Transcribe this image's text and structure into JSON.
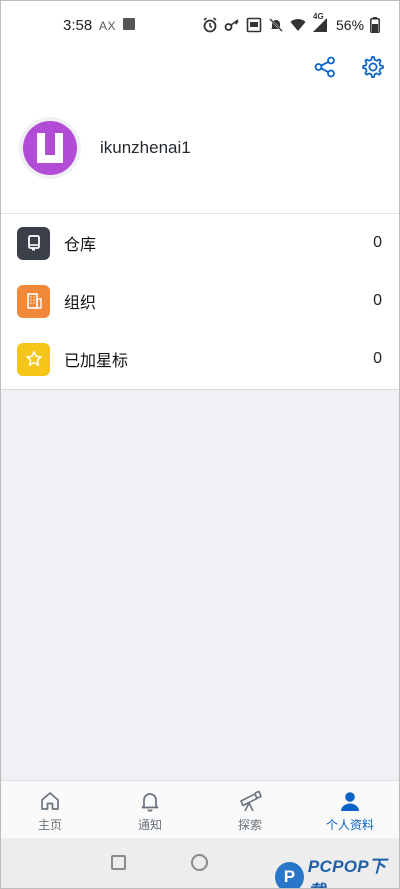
{
  "status_bar": {
    "time": "3:58",
    "indicator": "AX",
    "network": "4G",
    "battery": "56%",
    "icons": [
      "image-icon",
      "alarm-icon",
      "key-icon",
      "vpn-icon",
      "mute-icon",
      "wifi-icon",
      "signal-icon",
      "battery-icon"
    ]
  },
  "header": {
    "actions": [
      "share-icon",
      "settings-icon"
    ]
  },
  "profile": {
    "username": "ikunzhenai1",
    "avatar_color": "#b24cd6"
  },
  "list": [
    {
      "label": "仓库",
      "count": "0",
      "icon": "repository-icon",
      "color": "#3a3f4a"
    },
    {
      "label": "组织",
      "count": "0",
      "icon": "organization-icon",
      "color": "#f08a3a"
    },
    {
      "label": "已加星标",
      "count": "0",
      "icon": "star-icon",
      "color": "#f5c518"
    }
  ],
  "bottom_nav": [
    {
      "label": "主页",
      "icon": "home-icon",
      "active": false
    },
    {
      "label": "通知",
      "icon": "bell-icon",
      "active": false
    },
    {
      "label": "探索",
      "icon": "telescope-icon",
      "active": false
    },
    {
      "label": "个人资料",
      "icon": "person-icon",
      "active": true
    }
  ],
  "accent_color": "#0a63c9",
  "watermark": {
    "badge": "P",
    "text": "PCPOP下载"
  }
}
